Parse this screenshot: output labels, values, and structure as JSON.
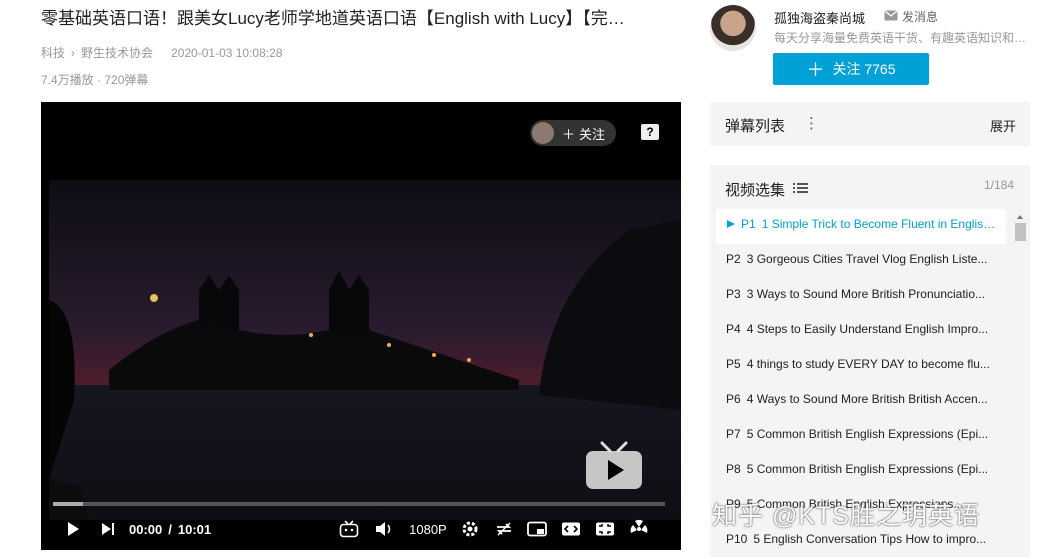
{
  "video": {
    "title": "零基础英语口语！跟美女Lucy老师学地道英语口语【English with Lucy】【完…",
    "category": "科技",
    "subcategory": "野生技术协会",
    "date": "2020-01-03 10:08:28",
    "stats": "7.4万播放 · 720弹幕"
  },
  "player": {
    "follow_label": "关注",
    "help_icon": "?",
    "current_time": "00:00",
    "separator": "/",
    "duration": "10:01",
    "quality": "1080P",
    "progress_fraction": 0.0
  },
  "uploader": {
    "name": "孤独海盗秦尚城",
    "message_label": "发消息",
    "signature": "每天分享海量免费英语干货、有趣英语知识和…",
    "follow_button": "关注 7765"
  },
  "danmu": {
    "label": "弹幕列表",
    "expand": "展开"
  },
  "playlist": {
    "label": "视频选集",
    "count": "1/184",
    "episodes": [
      {
        "num": "P1",
        "title": "1 Simple Trick to Become Fluent in English..."
      },
      {
        "num": "P2",
        "title": "3 Gorgeous Cities Travel Vlog English Liste..."
      },
      {
        "num": "P3",
        "title": "3 Ways to Sound More British Pronunciatio..."
      },
      {
        "num": "P4",
        "title": "4 Steps to Easily Understand English Impro..."
      },
      {
        "num": "P5",
        "title": "4 things to study EVERY DAY to become flu..."
      },
      {
        "num": "P6",
        "title": "4 Ways to Sound More British British Accen..."
      },
      {
        "num": "P7",
        "title": "5 Common British English Expressions (Epi..."
      },
      {
        "num": "P8",
        "title": "5 Common British English Expressions (Epi..."
      },
      {
        "num": "P9",
        "title": "5 Common British English Expressions..."
      },
      {
        "num": "P10",
        "title": "5 English Conversation Tips How to impro..."
      }
    ]
  },
  "watermark": "知乎 @KTS胜之玥英语",
  "colors": {
    "accent": "#00a1d6",
    "panel": "#f4f4f4"
  }
}
